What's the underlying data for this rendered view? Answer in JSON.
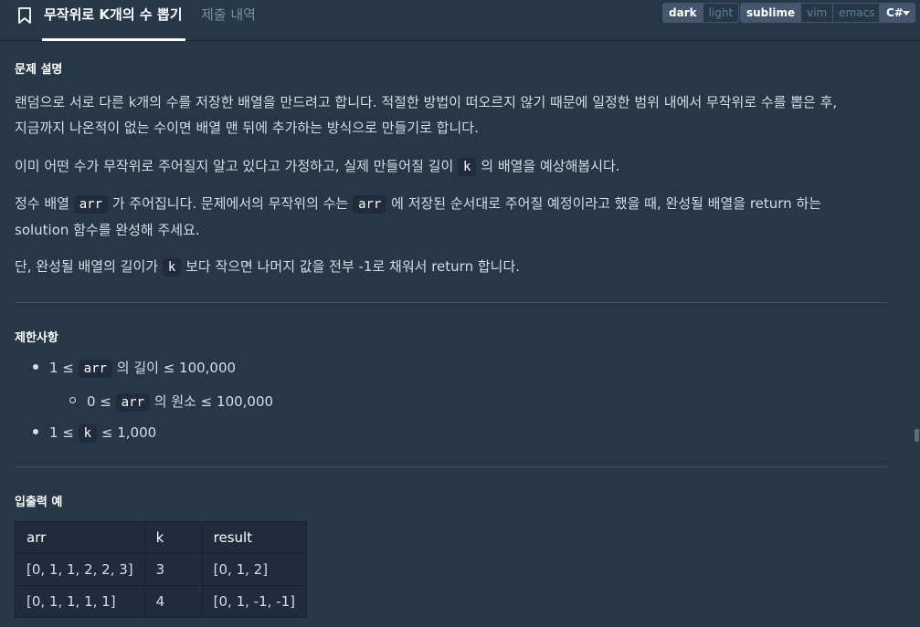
{
  "header": {
    "tab_title": "무작위로 K개의 수 뽑기",
    "tab_submissions": "제출 내역",
    "theme_options": [
      "dark",
      "light"
    ],
    "theme_selected": "dark",
    "keymap_options": [
      "sublime",
      "vim",
      "emacs"
    ],
    "keymap_selected": "sublime",
    "language": "C#"
  },
  "problem": {
    "section_title": "문제 설명",
    "para1_line1": "랜덤으로 서로 다른 k개의 수를 저장한 배열을 만드려고 합니다. 적절한 방법이 떠오르지 않기 때문에 일정한 범위 내에서 무작위로 수를 뽑은 후,",
    "para1_line2": "지금까지 나온적이 없는 수이면 배열 맨 뒤에 추가하는 방식으로 만들기로 합니다.",
    "para2_before": "이미 어떤 수가 무작위로 주어질지 알고 있다고 가정하고, 실제 만들어질 길이",
    "para2_code": "k",
    "para2_after": "의 배열을 예상해봅시다.",
    "para3_a": "정수 배열",
    "para3_code1": "arr",
    "para3_b": "가 주어집니다. 문제에서의 무작위의 수는",
    "para3_code2": "arr",
    "para3_c": "에 저장된 순서대로 주어질 예정이라고 했을 때, 완성될 배열을 return 하는",
    "para3_line2": "solution 함수를 완성해 주세요.",
    "para4_a": "단, 완성될 배열의 길이가",
    "para4_code": "k",
    "para4_b": "보다 작으면 나머지 값을 전부 -1로 채워서 return 합니다."
  },
  "constraints": {
    "section_title": "제한사항",
    "c1_a": "1 ≤",
    "c1_code": "arr",
    "c1_b": "의 길이 ≤ 100,000",
    "c2_a": "0 ≤",
    "c2_code": "arr",
    "c2_b": "의 원소 ≤ 100,000",
    "c3_a": "1 ≤",
    "c3_code": "k",
    "c3_b": "≤ 1,000"
  },
  "examples": {
    "section_title": "입출력 예",
    "headers": [
      "arr",
      "k",
      "result"
    ],
    "rows": [
      [
        "[0, 1, 1, 2, 2, 3]",
        "3",
        "[0, 1, 2]"
      ],
      [
        "[0, 1, 1, 1, 1]",
        "4",
        "[0, 1, -1, -1]"
      ]
    ]
  },
  "icons": [
    "bookmark-icon",
    "chevron-down-icon"
  ]
}
